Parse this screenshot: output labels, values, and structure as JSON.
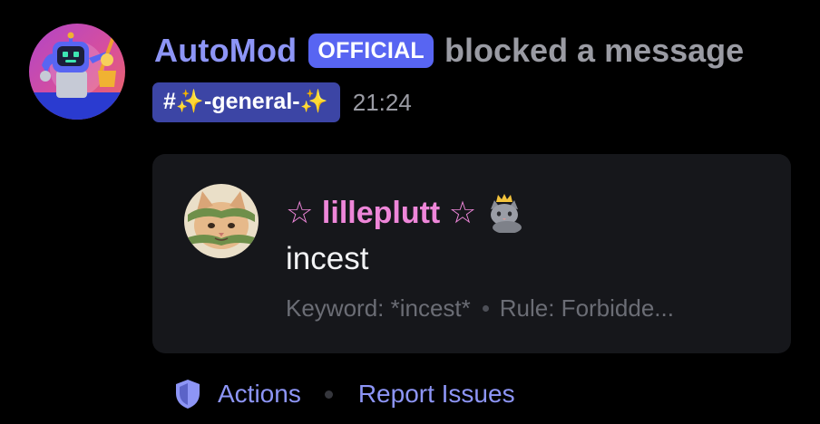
{
  "message": {
    "author_name": "AutoMod",
    "badge_label": "OFFICIAL",
    "action_text": "blocked a message",
    "channel_label": "#✨-general-✨",
    "timestamp": "21:24"
  },
  "blocked": {
    "username": "☆ lilleplutt ☆",
    "username_emoji": "cat-with-crown-emoji",
    "content": "incest",
    "keyword_text": "Keyword: *incest*",
    "rule_text": "Rule: Forbidde..."
  },
  "footer": {
    "actions_label": "Actions",
    "actions_icon": "shield-icon",
    "report_label": "Report Issues"
  },
  "colors": {
    "background": "#000000",
    "brand_blurple": "#5865f2",
    "author_name": "#8d95f6",
    "username_pink": "#ee86d9",
    "card_background": "#16171b",
    "muted_text": "#9a9ba3"
  }
}
